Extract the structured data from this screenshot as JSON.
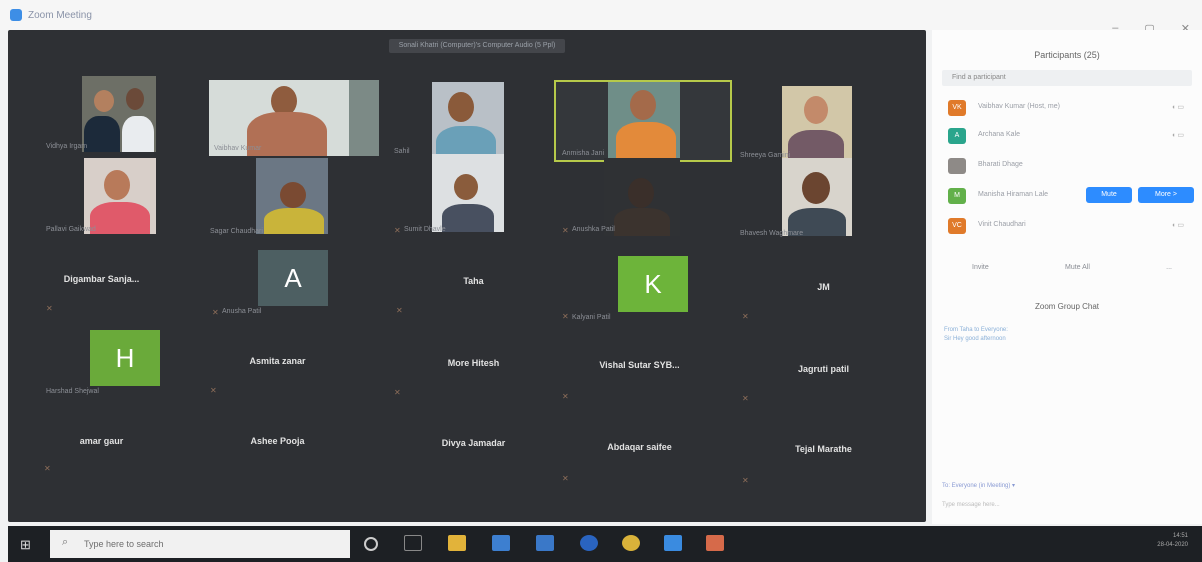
{
  "window": {
    "title": "Zoom Meeting"
  },
  "meeting": {
    "banner": "Sonali Khatri (Computer)'s Computer Audio (5 Ppl)"
  },
  "tiles": [
    {
      "name": "Vidhya Irgam",
      "kind": "video"
    },
    {
      "name": "Vaibhav Kumar",
      "kind": "video"
    },
    {
      "name": "Sahil",
      "kind": "video"
    },
    {
      "name": "Anmisha Jani",
      "kind": "video"
    },
    {
      "name": "Shreeya Gamini",
      "kind": "video"
    },
    {
      "name": "Pallavi Gaikwad",
      "kind": "video"
    },
    {
      "name": "Sagar Chaudhari",
      "kind": "video"
    },
    {
      "name": "Sumit Dhavle",
      "kind": "video"
    },
    {
      "name": "Anushka Patil",
      "kind": "video"
    },
    {
      "name": "Bhavesh Waghmare",
      "kind": "video"
    },
    {
      "name": "Digambar  Sanja...",
      "kind": "name"
    },
    {
      "name": "Anusha Patil",
      "kind": "avatar",
      "letter": "A"
    },
    {
      "name": "Taha",
      "kind": "name"
    },
    {
      "name": "Kalyani Patil",
      "kind": "avatar",
      "letter": "K"
    },
    {
      "name": "JM",
      "kind": "name"
    },
    {
      "name": "Harshad Shejwal",
      "kind": "avatar",
      "letter": "H"
    },
    {
      "name": "Asmita zanar",
      "kind": "name"
    },
    {
      "name": "More Hitesh",
      "kind": "name"
    },
    {
      "name": "Vishal Sutar SYB...",
      "kind": "name"
    },
    {
      "name": "Jagruti patil",
      "kind": "name"
    },
    {
      "name": "amar gaur",
      "kind": "name"
    },
    {
      "name": "Ashee Pooja",
      "kind": "name"
    },
    {
      "name": "Divya Jamadar",
      "kind": "name"
    },
    {
      "name": "Abdaqar saifee",
      "kind": "name"
    },
    {
      "name": "Tejal Marathe",
      "kind": "name"
    }
  ],
  "panel": {
    "title": "Participants (25)",
    "search_placeholder": "Find a participant",
    "participants": [
      {
        "initials": "VK",
        "name": "Vaibhav Kumar (Host, me)",
        "color": "#e07a2a"
      },
      {
        "initials": "A",
        "name": "Archana Kale",
        "color": "#2aa58c"
      },
      {
        "initials": "",
        "name": "Bharati Dhage",
        "color": "#8e8a87"
      },
      {
        "initials": "M",
        "name": "Manisha Hiraman Lale",
        "color": "#62b04a"
      },
      {
        "initials": "VC",
        "name": "Vinit Chaudhari",
        "color": "#e07a2a"
      }
    ],
    "mute_label": "Mute",
    "more_label": "More >",
    "invite_label": "Invite",
    "mute_all_label": "Mute All",
    "more_dots": "...",
    "chat_title": "Zoom Group Chat",
    "chat_message_1": "From Taha to Everyone:",
    "chat_message_2": "Sir Hey good afternoon",
    "chat_to_label": "To: Everyone (in Meeting) ▾",
    "chat_input_placeholder": "Type message here..."
  },
  "taskbar": {
    "search_placeholder": "Type here to search",
    "time": "14:51",
    "date": "28-04-2020"
  },
  "colors": {
    "avatar_A": "#4d5f62",
    "avatar_K": "#6db43a",
    "avatar_H": "#6aaa3a",
    "accent_blue": "#2d8cff"
  },
  "icons": [
    "windows-start-icon",
    "search-icon",
    "mic-muted-icon",
    "cortana-icon",
    "task-view-icon",
    "file-explorer-icon",
    "store-icon",
    "mail-icon",
    "edge-icon",
    "chrome-icon",
    "zoom-icon",
    "paint-icon"
  ]
}
